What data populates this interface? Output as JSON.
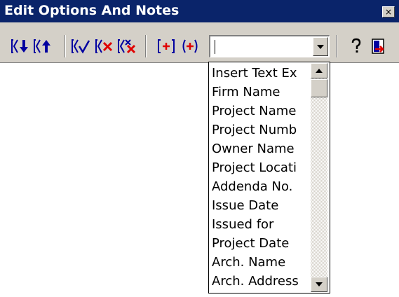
{
  "window": {
    "title": "Edit Options And Notes",
    "close_glyph": "×"
  },
  "toolbar": {
    "buttons": [
      {
        "name": "move-down-icon"
      },
      {
        "name": "move-up-icon"
      },
      {
        "name": "check-icon"
      },
      {
        "name": "delete-icon"
      },
      {
        "name": "delete-all-icon"
      },
      {
        "name": "insert-bracket-plus-icon"
      },
      {
        "name": "insert-paren-plus-icon"
      }
    ],
    "combo_value": "",
    "help_icon": "help-icon",
    "exit_icon": "exit-icon"
  },
  "dropdown": {
    "items": [
      "Insert Text Ex",
      "Firm Name",
      "Project Name",
      "Project Numb",
      "Owner Name",
      "Project Locati",
      "Addenda No.",
      "Issue Date",
      "Issued for",
      "Project Date",
      "Arch. Name",
      "Arch. Address"
    ]
  },
  "colors": {
    "titlebar": "#0a246a",
    "face": "#d4d0c8",
    "icon_blue": "#0000a0",
    "icon_red": "#e00000"
  }
}
